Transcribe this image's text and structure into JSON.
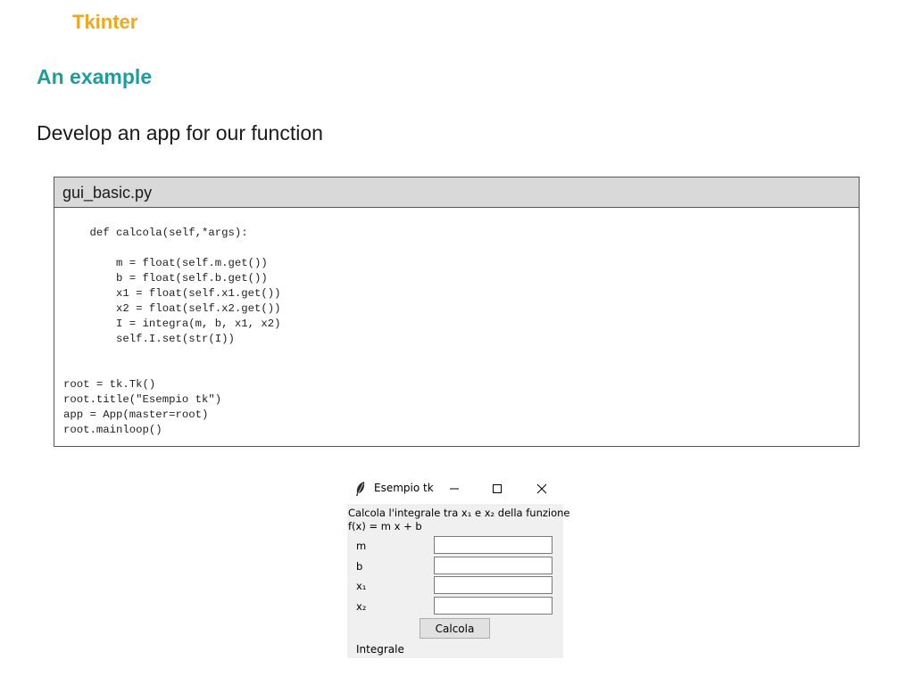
{
  "slide": {
    "section_title": "Tkinter",
    "heading": "An example",
    "text": "Develop an app for our function"
  },
  "code": {
    "filename": "gui_basic.py",
    "lines": [
      "    def calcola(self,*args):",
      "",
      "        m = float(self.m.get())",
      "        b = float(self.b.get())",
      "        x1 = float(self.x1.get())",
      "        x2 = float(self.x2.get())",
      "        I = integra(m, b, x1, x2)",
      "        self.I.set(str(I))",
      "",
      "",
      "root = tk.Tk()",
      "root.title(\"Esempio tk\")",
      "app = App(master=root)",
      "root.mainloop()"
    ]
  },
  "tk_window": {
    "title": "Esempio tk",
    "description_line1": "Calcola l'integrale tra x₁ e x₂ della funzione",
    "description_line2": "f(x) = m x + b",
    "fields": [
      {
        "label": "m",
        "value": ""
      },
      {
        "label": "b",
        "value": ""
      },
      {
        "label": "x₁",
        "value": ""
      },
      {
        "label": "x₂",
        "value": ""
      }
    ],
    "button_label": "Calcola",
    "result_label": "Integrale",
    "icons": {
      "app": "feather-icon",
      "minimize": "minimize-icon",
      "maximize": "maximize-icon",
      "close": "close-icon"
    }
  },
  "colors": {
    "section_title": "#f4a71d",
    "heading": "#1a9e9e",
    "code_header_bg": "#d9d9d9",
    "window_bg": "#f0f0f0"
  }
}
